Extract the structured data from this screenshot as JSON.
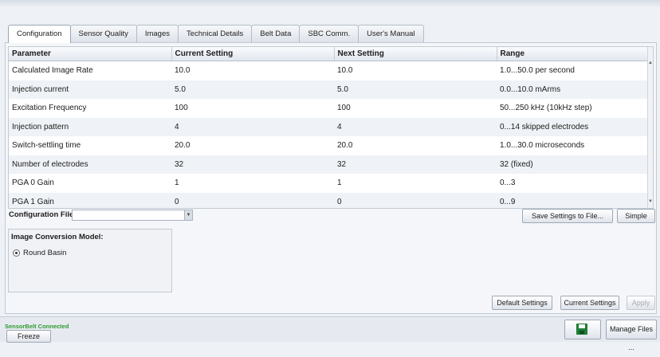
{
  "tabs": [
    "Configuration",
    "Sensor Quality",
    "Images",
    "Technical Details",
    "Belt Data",
    "SBC Comm.",
    "User's Manual"
  ],
  "table": {
    "headers": [
      "Parameter",
      "Current Setting",
      "Next Setting",
      "Range"
    ],
    "rows": [
      [
        "Calculated Image Rate",
        "10.0",
        "10.0",
        "1.0...50.0 per second"
      ],
      [
        "Injection current",
        "5.0",
        "5.0",
        "0.0...10.0 mArms"
      ],
      [
        "Excitation Frequency",
        "100",
        "100",
        "50...250 kHz (10kHz step)"
      ],
      [
        "Injection pattern",
        "4",
        "4",
        "0...14 skipped electrodes"
      ],
      [
        "Switch-settling time",
        "20.0",
        "20.0",
        "1.0...30.0 microseconds"
      ],
      [
        "Number of electrodes",
        "32",
        "32",
        "32 (fixed)"
      ],
      [
        "PGA 0 Gain",
        "1",
        "1",
        "0...3"
      ],
      [
        "PGA 1 Gain",
        "0",
        "0",
        "0...9"
      ]
    ]
  },
  "config_file": {
    "label": "Configuration File:",
    "value": ""
  },
  "buttons": {
    "save_settings": "Save Settings to File...",
    "simple": "Simple",
    "default_settings": "Default Settings",
    "current_settings": "Current Settings",
    "apply": "Apply",
    "freeze": "Freeze",
    "manage_files": "Manage Files ..."
  },
  "image_conversion": {
    "title": "Image Conversion Model:",
    "option": "Round Basin"
  },
  "status": {
    "text": "SensorBelt Connected",
    "color": "#2e9a2e"
  },
  "icons": {
    "save": "floppy-disk-icon"
  }
}
